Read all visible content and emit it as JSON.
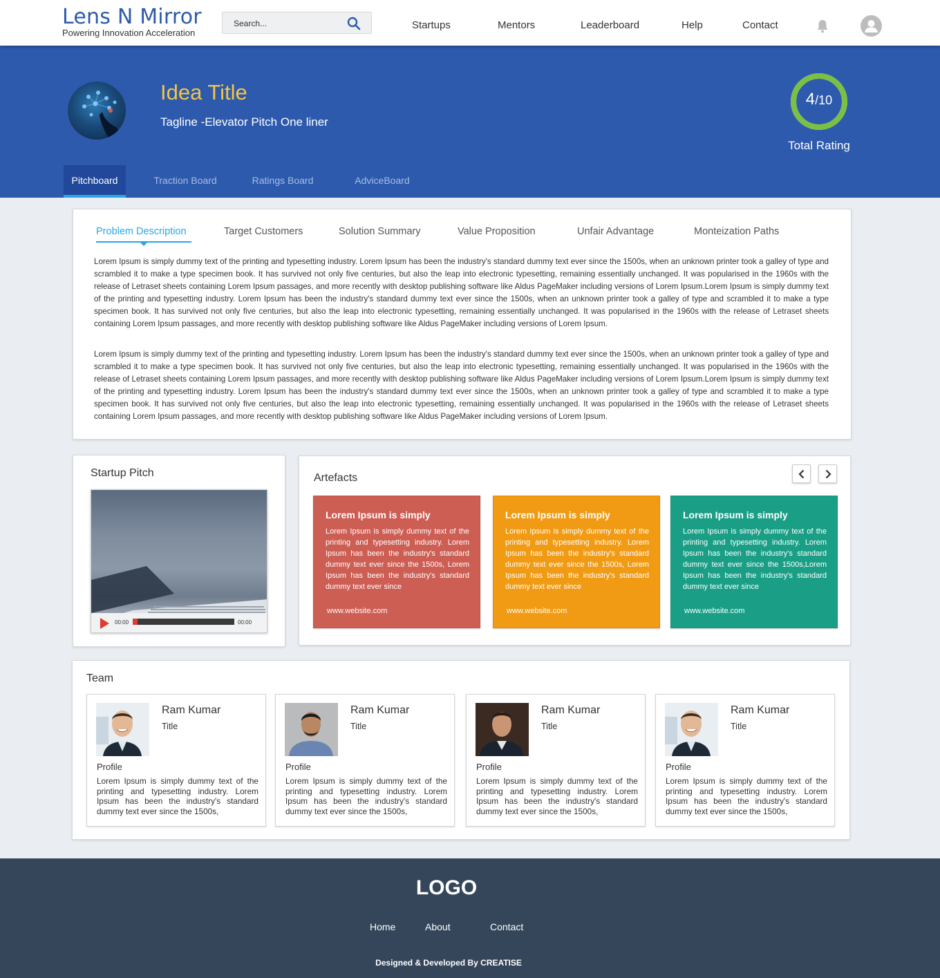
{
  "brand": {
    "title": "Lens N Mirror",
    "subtitle": "Powering Innovation Acceleration"
  },
  "search": {
    "placeholder": "Search...",
    "icon": "search-icon"
  },
  "nav": {
    "items": [
      "Startups",
      "Mentors",
      "Leaderboard",
      "Help",
      "Contact"
    ]
  },
  "hero": {
    "title": "Idea Title",
    "tagline": "Tagline  -Elevator Pitch One liner",
    "rating": {
      "value": "4",
      "max": "/10",
      "fraction": 0.4,
      "label": "Total Rating"
    },
    "tabs": [
      "Pitchboard",
      "Traction Board",
      "Ratings Board",
      "AdviceBoard"
    ],
    "active_tab": "Pitchboard"
  },
  "colors": {
    "primary": "#2d5aad",
    "accent": "#29a6e6",
    "title_yellow": "#f5c542",
    "rating_green": "#7ac143",
    "footer": "#35465b"
  },
  "problem": {
    "tabs": [
      "Problem Description",
      "Target Customers",
      "Solution Summary",
      "Value Proposition",
      "Unfair Advantage",
      "Monteization Paths"
    ],
    "paragraphs": [
      "Lorem Ipsum is simply dummy text of the printing and typesetting industry. Lorem Ipsum has been the industry's standard dummy text ever since the 1500s, when an unknown printer took a galley of type and scrambled it to make a type specimen book. It has survived not only five centuries, but also the leap into electronic typesetting, remaining essentially unchanged. It was popularised in the 1960s with the release of Letraset sheets containing Lorem Ipsum passages, and more recently with desktop publishing software like Aldus PageMaker including versions of Lorem Ipsum.Lorem Ipsum is simply dummy text of the printing and typesetting industry. Lorem Ipsum has been the industry's standard dummy text ever since the 1500s, when an unknown printer took a galley of type and scrambled it to make a type specimen book. It has survived not only five centuries, but also the leap into electronic typesetting, remaining essentially unchanged. It was popularised in the 1960s with the release of Letraset sheets containing Lorem Ipsum passages, and more recently with desktop publishing software like Aldus PageMaker including versions of Lorem Ipsum.",
      "Lorem Ipsum is simply dummy text of the printing and typesetting industry. Lorem Ipsum has been the industry's standard dummy text ever since the 1500s, when an unknown printer took a galley of type and scrambled it to make a type specimen book. It has survived not only five centuries, but also the leap into electronic typesetting, remaining essentially unchanged. It was popularised in the 1960s with the release of Letraset sheets containing Lorem Ipsum passages, and more recently with desktop publishing software like Aldus PageMaker including versions of Lorem Ipsum.Lorem Ipsum is simply dummy text of the printing and typesetting industry. Lorem Ipsum has been the industry's standard dummy text ever since the 1500s, when an unknown printer took a galley of type and scrambled it to make a type specimen book. It has survived not only five centuries, but also the leap into electronic typesetting, remaining essentially unchanged. It was popularised in the 1960s with the release of Letraset sheets containing Lorem Ipsum passages, and more recently with desktop publishing software like Aldus PageMaker including versions of Lorem Ipsum."
    ]
  },
  "pitch": {
    "title": "Startup Pitch",
    "time_start": "00:00",
    "time_end": "00:00",
    "progress": 0.05
  },
  "artefacts": {
    "title": "Artefacts",
    "cards": [
      {
        "title": "Lorem Ipsum is simply",
        "body": "Lorem Ipsum is simply dummy text of the printing and typesetting industry. Lorem Ipsum has been the industry's standard dummy text ever since the 1500s, Lorem Ipsum has been the industry's standard dummy text ever since",
        "link": "www.website.com",
        "color": "#cd5e54"
      },
      {
        "title": "Lorem Ipsum is simply",
        "body": "Lorem Ipsum is simply dummy text of the printing and typesetting industry. Lorem Ipsum has been the industry's standard dummy text ever since the 1500s, Lorem Ipsum has been the industry's standard dummy text ever since",
        "link": "www.website.com",
        "color": "#f19b14"
      },
      {
        "title": "Lorem Ipsum is simply",
        "body": "Lorem Ipsum is simply dummy text of the printing and typesetting industry. Lorem Ipsum has been the industry's standard dummy text ever since the 1500s,Lorem Ipsum has been the industry's standard dummy text ever since",
        "link": "www.website.com",
        "color": "#1a9f86"
      }
    ]
  },
  "team": {
    "title": "Team",
    "members": [
      {
        "name": "Ram Kumar",
        "title": "Title",
        "profile_label": "Profile",
        "bio": "Lorem Ipsum is simply dummy text of the printing and typesetting industry. Lorem Ipsum has been the industry's standard dummy text ever since the 1500s,"
      },
      {
        "name": "Ram Kumar",
        "title": "Title",
        "profile_label": "Profile",
        "bio": "Lorem Ipsum is simply dummy text of the printing and typesetting industry. Lorem Ipsum has been the industry's standard dummy text ever since the 1500s,"
      },
      {
        "name": "Ram Kumar",
        "title": "Title",
        "profile_label": "Profile",
        "bio": "Lorem Ipsum is simply dummy text of the printing and typesetting industry. Lorem Ipsum has been the industry's standard dummy text ever since the 1500s,"
      },
      {
        "name": "Ram Kumar",
        "title": "Title",
        "profile_label": "Profile",
        "bio": "Lorem Ipsum is simply dummy text of the printing and typesetting industry. Lorem Ipsum has been the industry's standard dummy text ever since the 1500s,"
      }
    ]
  },
  "footer": {
    "logo": "LOGO",
    "links": [
      "Home",
      "About",
      "Contact"
    ],
    "credit": "Designed & Developed By CREATISE"
  }
}
